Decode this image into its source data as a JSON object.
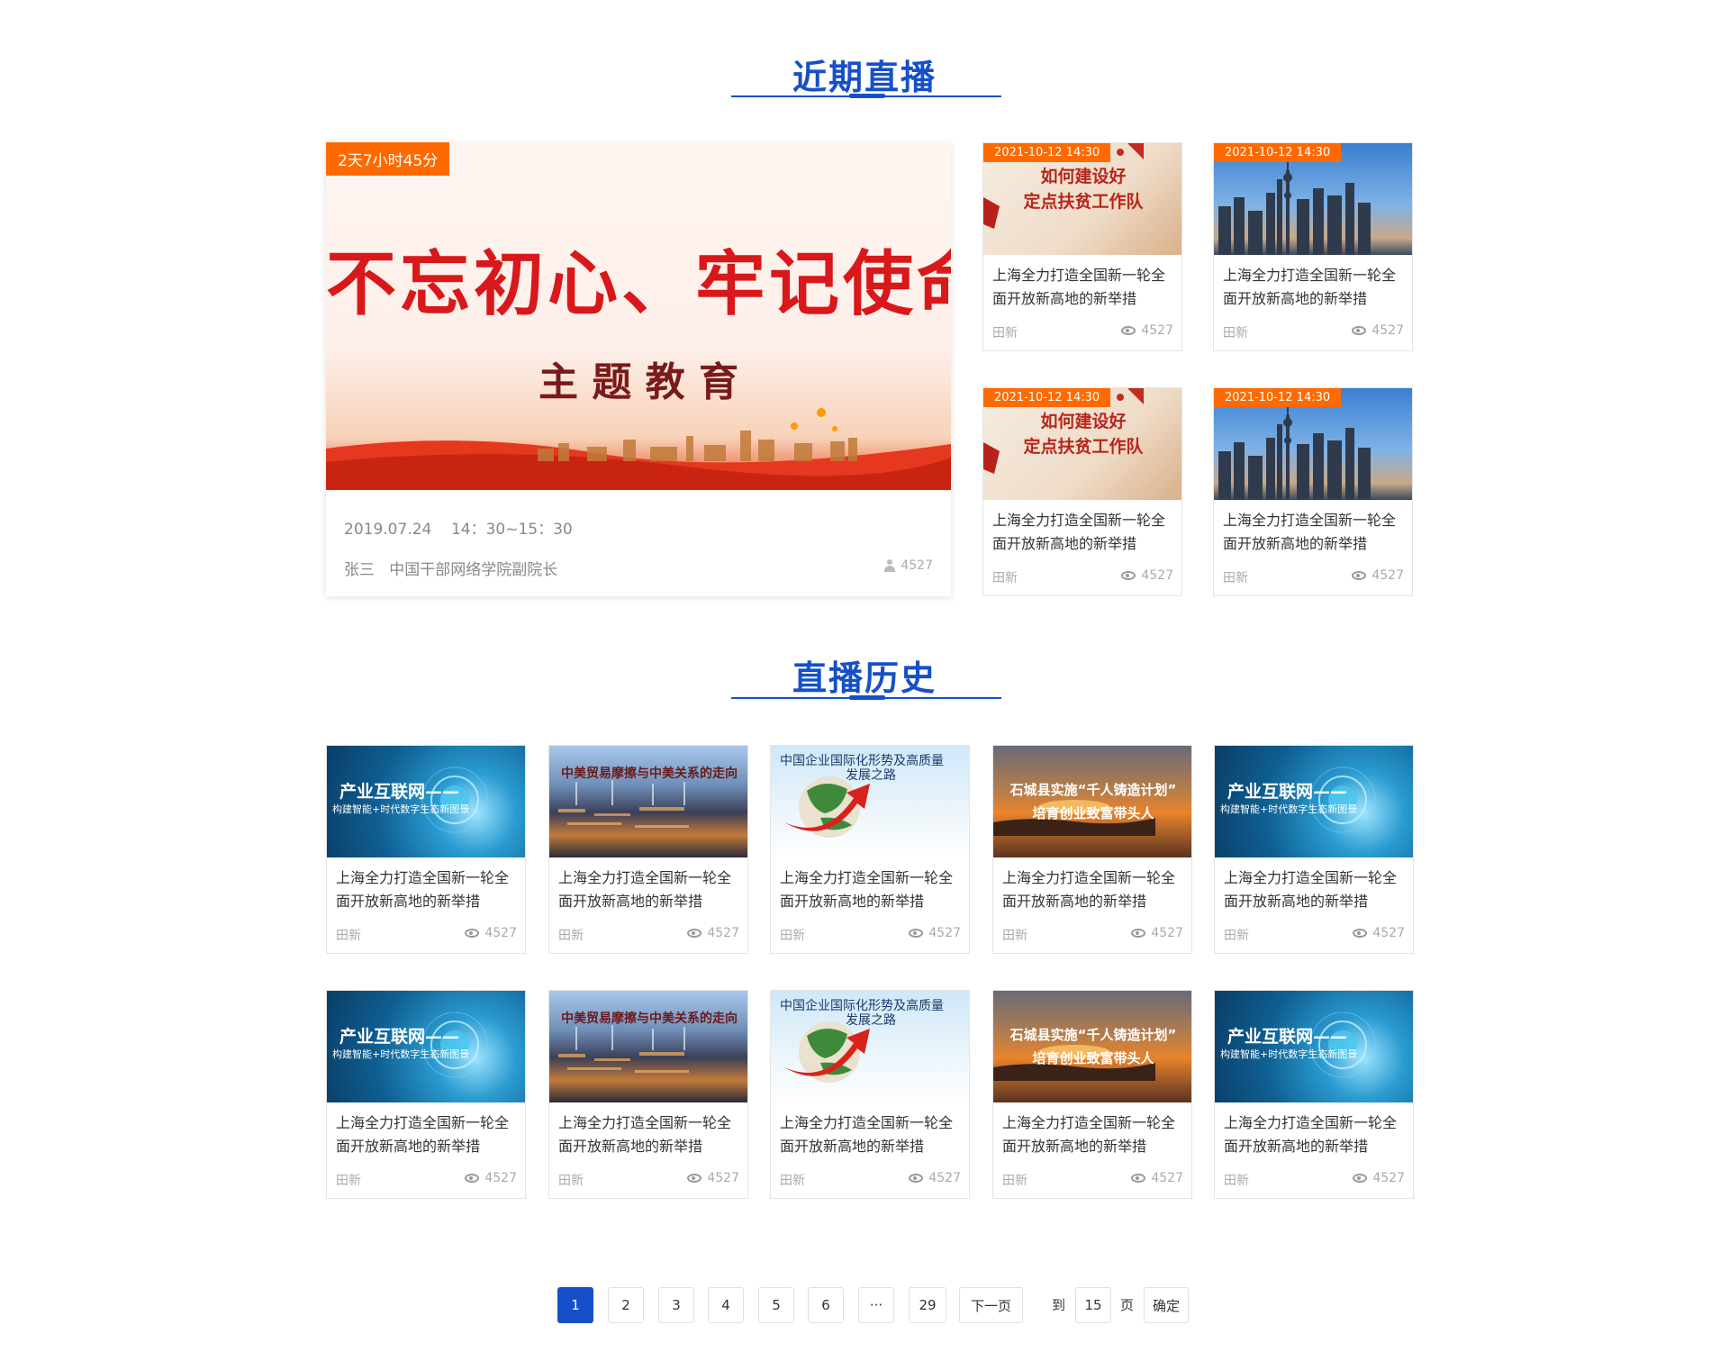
{
  "live": {
    "title": "近期直播",
    "featured": {
      "countdown": "2天7小时45分",
      "banner_line1": "不忘初心、牢记使命",
      "banner_line2": "主 题 教 育",
      "datetime": "2019.07.24    14：30~15：30",
      "speaker": "张三   中国干部网络学院副院长",
      "count": "4527"
    },
    "cards": [
      {
        "date": "2021-10-12 14:30",
        "image_text1": "如何建设好",
        "image_text2": "定点扶贫工作队",
        "title": "上海全力打造全国新一轮全面开放新高地的新举措",
        "author": "田新",
        "views": "4527"
      },
      {
        "date": "2021-10-12 14:30",
        "image_text1": "",
        "image_text2": "",
        "title": "上海全力打造全国新一轮全面开放新高地的新举措",
        "author": "田新",
        "views": "4527"
      },
      {
        "date": "2021-10-12 14:30",
        "image_text1": "如何建设好",
        "image_text2": "定点扶贫工作队",
        "title": "上海全力打造全国新一轮全面开放新高地的新举措",
        "author": "田新",
        "views": "4527"
      },
      {
        "date": "2021-10-12 14:30",
        "image_text1": "",
        "image_text2": "",
        "title": "上海全力打造全国新一轮全面开放新高地的新举措",
        "author": "田新",
        "views": "4527"
      }
    ]
  },
  "history": {
    "title": "直播历史",
    "cards": [
      {
        "image_text1": "产业互联网——",
        "image_text2": "构建智能+时代数字生态新图景",
        "title": "上海全力打造全国新一轮全面开放新高地的新举措",
        "author": "田新",
        "views": "4527"
      },
      {
        "image_text1": "中美贸易摩擦与中美关系的走向",
        "image_text2": "",
        "title": "上海全力打造全国新一轮全面开放新高地的新举措",
        "author": "田新",
        "views": "4527"
      },
      {
        "image_text1": "中国企业国际化形势及高质量",
        "image_text2": "发展之路",
        "title": "上海全力打造全国新一轮全面开放新高地的新举措",
        "author": "田新",
        "views": "4527"
      },
      {
        "image_text1": "石城县实施“千人铸造计划”",
        "image_text2": "培育创业致富带头人",
        "title": "上海全力打造全国新一轮全面开放新高地的新举措",
        "author": "田新",
        "views": "4527"
      },
      {
        "image_text1": "产业互联网——",
        "image_text2": "构建智能+时代数字生态新图景",
        "title": "上海全力打造全国新一轮全面开放新高地的新举措",
        "author": "田新",
        "views": "4527"
      },
      {
        "image_text1": "产业互联网——",
        "image_text2": "构建智能+时代数字生态新图景",
        "title": "上海全力打造全国新一轮全面开放新高地的新举措",
        "author": "田新",
        "views": "4527"
      },
      {
        "image_text1": "中美贸易摩擦与中美关系的走向",
        "image_text2": "",
        "title": "上海全力打造全国新一轮全面开放新高地的新举措",
        "author": "田新",
        "views": "4527"
      },
      {
        "image_text1": "中国企业国际化形势及高质量",
        "image_text2": "发展之路",
        "title": "上海全力打造全国新一轮全面开放新高地的新举措",
        "author": "田新",
        "views": "4527"
      },
      {
        "image_text1": "石城县实施“千人铸造计划”",
        "image_text2": "培育创业致富带头人",
        "title": "上海全力打造全国新一轮全面开放新高地的新举措",
        "author": "田新",
        "views": "4527"
      },
      {
        "image_text1": "产业互联网——",
        "image_text2": "构建智能+时代数字生态新图景",
        "title": "上海全力打造全国新一轮全面开放新高地的新举措",
        "author": "田新",
        "views": "4527"
      }
    ]
  },
  "pagination": {
    "pages": [
      "1",
      "2",
      "3",
      "4",
      "5",
      "6",
      "···",
      "29"
    ],
    "active": "1",
    "next": "下一页",
    "goto_prefix": "到",
    "goto_value": "15",
    "goto_suffix": "页",
    "confirm": "确定"
  }
}
